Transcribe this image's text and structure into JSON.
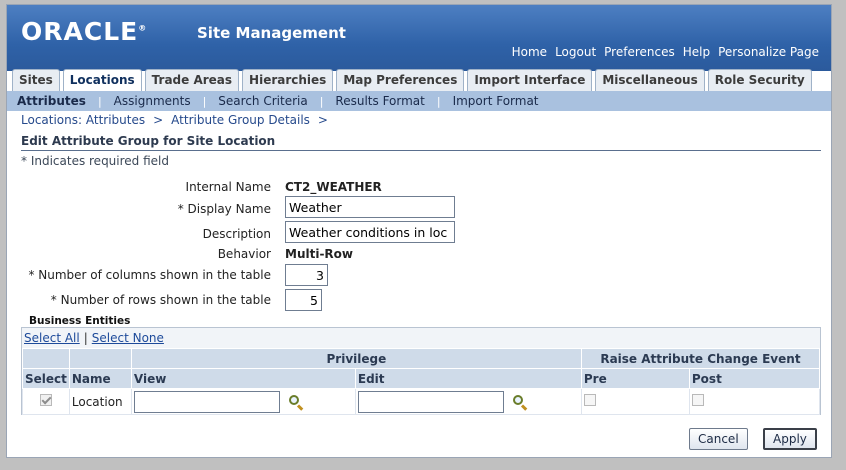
{
  "header": {
    "logo": "ORACLE",
    "logo_tm": "®",
    "app_title": "Site Management",
    "links": [
      "Home",
      "Logout",
      "Preferences",
      "Help",
      "Personalize Page"
    ]
  },
  "tabs": [
    {
      "label": "Sites",
      "active": false
    },
    {
      "label": "Locations",
      "active": true
    },
    {
      "label": "Trade Areas",
      "active": false
    },
    {
      "label": "Hierarchies",
      "active": false
    },
    {
      "label": "Map Preferences",
      "active": false
    },
    {
      "label": "Import Interface",
      "active": false
    },
    {
      "label": "Miscellaneous",
      "active": false
    },
    {
      "label": "Role Security",
      "active": false
    }
  ],
  "subtabs": [
    {
      "label": "Attributes",
      "active": true
    },
    {
      "label": "Assignments",
      "active": false
    },
    {
      "label": "Search Criteria",
      "active": false
    },
    {
      "label": "Results Format",
      "active": false
    },
    {
      "label": "Import Format",
      "active": false
    }
  ],
  "breadcrumbs": [
    "Locations: Attributes",
    "Attribute Group Details"
  ],
  "breadcrumb_sep": ">",
  "page": {
    "title": "Edit Attribute Group for Site Location",
    "required_note": "* Indicates required field"
  },
  "form": {
    "internal_name_label": "Internal Name",
    "internal_name_value": "CT2_WEATHER",
    "display_name_label": "* Display Name",
    "display_name_value": "Weather",
    "description_label": "Description",
    "description_value": "Weather conditions in loc",
    "behavior_label": "Behavior",
    "behavior_value": "Multi-Row",
    "columns_label": "* Number of columns shown in the table",
    "columns_value": "3",
    "rows_label": "* Number of rows shown in the table",
    "rows_value": "5"
  },
  "business_entities": {
    "title": "Business Entities",
    "select_all": "Select All",
    "select_none": "Select None",
    "group_privilege": "Privilege",
    "group_event": "Raise Attribute Change Event",
    "col_select": "Select",
    "col_name": "Name",
    "col_view": "View",
    "col_edit": "Edit",
    "col_pre": "Pre",
    "col_post": "Post",
    "rows": [
      {
        "name": "Location",
        "selected": true,
        "view": "",
        "edit": "",
        "pre": false,
        "post": false
      }
    ]
  },
  "buttons": {
    "cancel": "Cancel",
    "apply": "Apply"
  },
  "colors": {
    "header_blue": "#2f62a8",
    "subtab_bar": "#a9c1df",
    "table_header": "#cfdbe9"
  }
}
